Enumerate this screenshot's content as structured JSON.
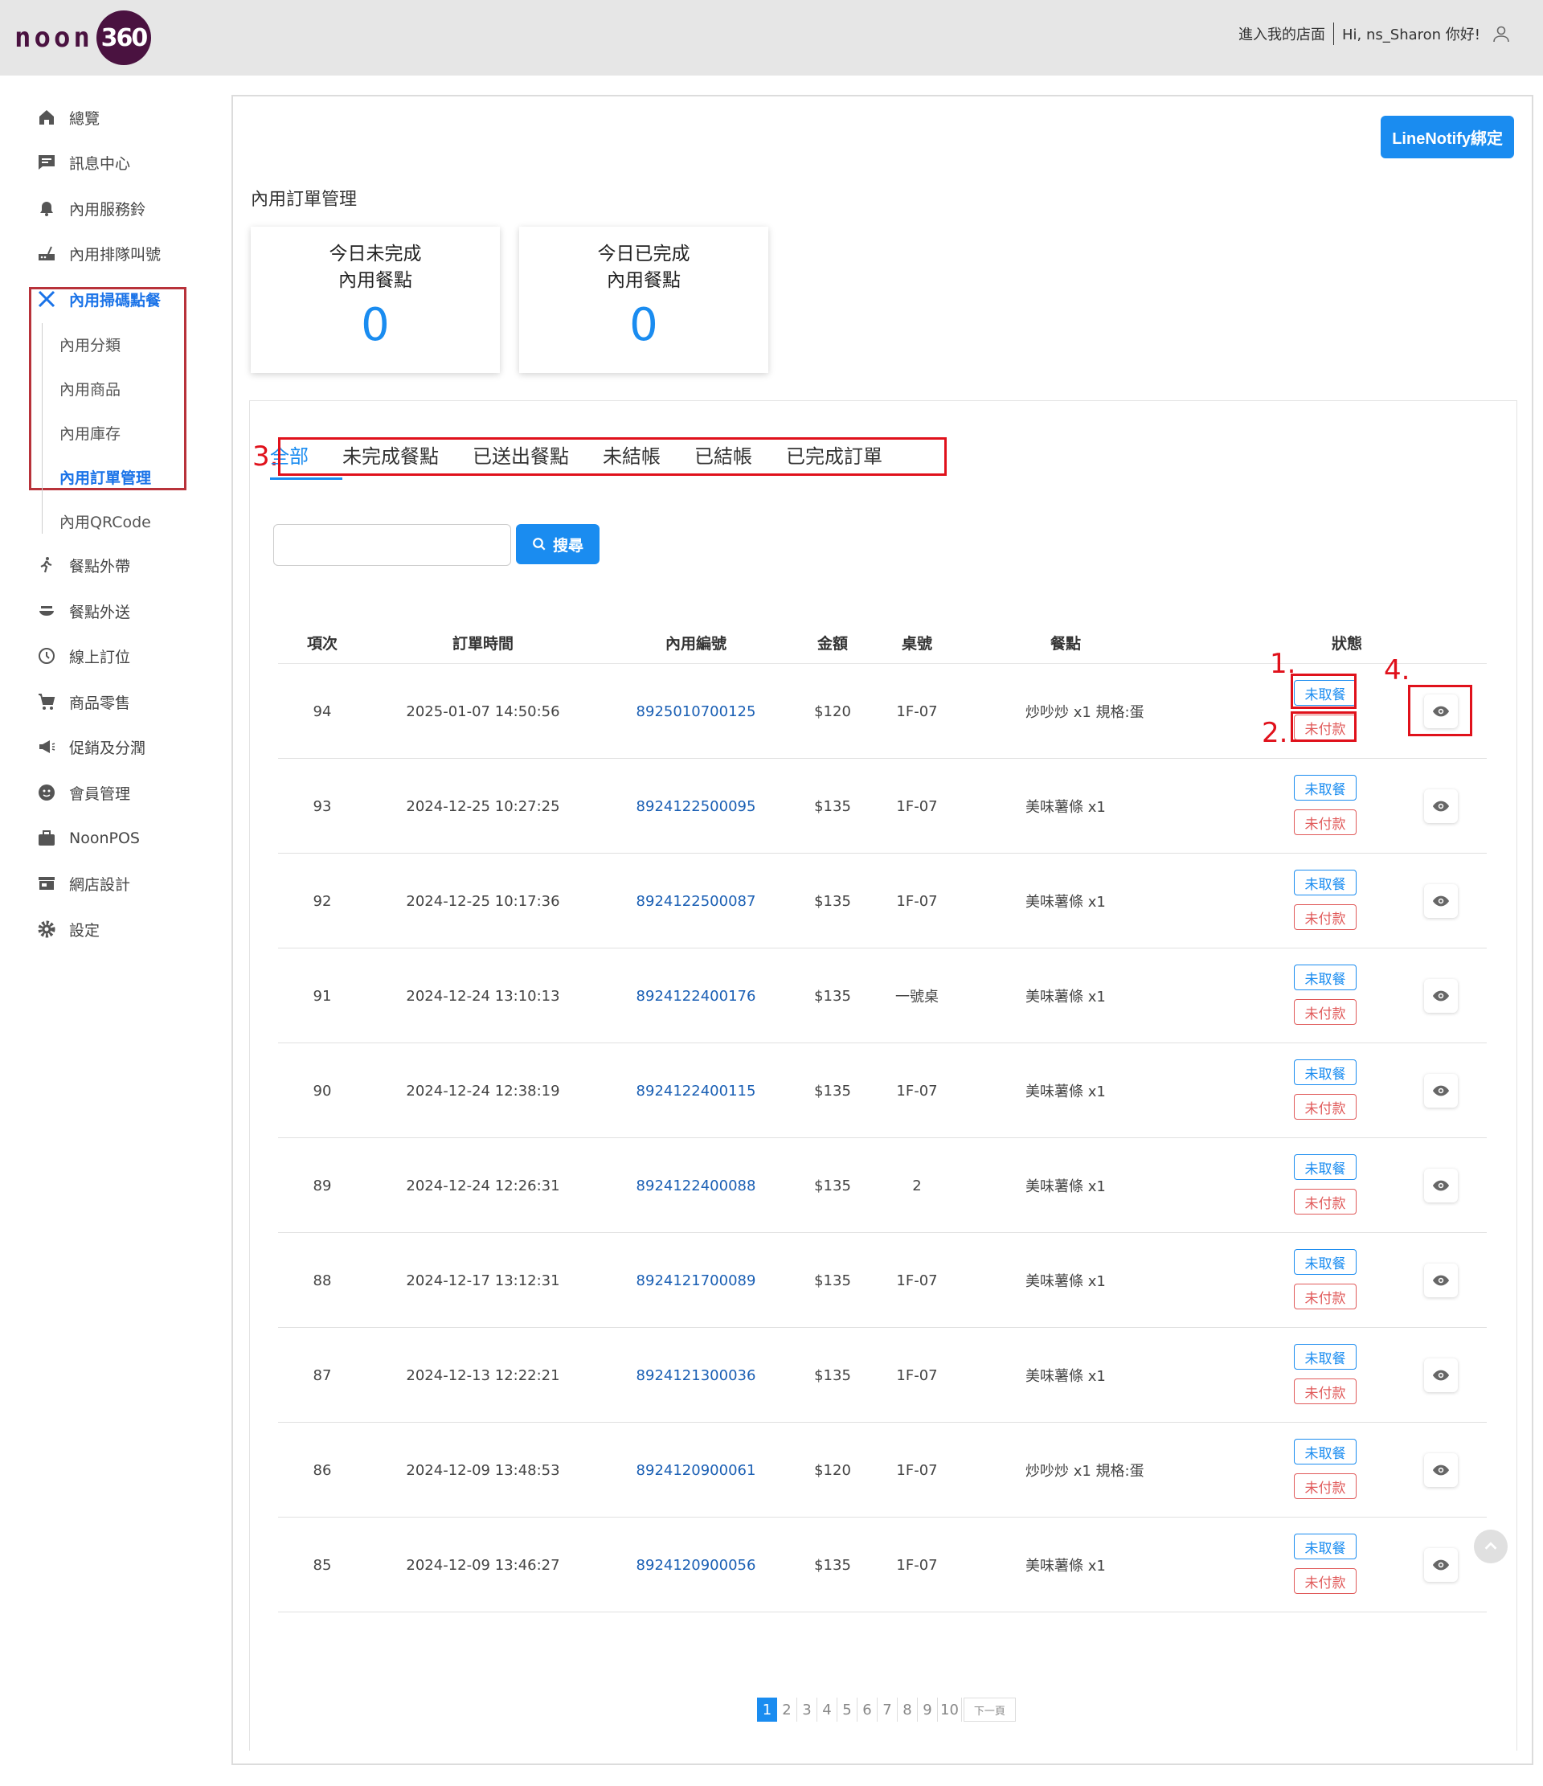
{
  "header": {
    "logo_text": "noon",
    "logo_badge": "360",
    "enter_store": "進入我的店面",
    "greeting": "Hi, ns_Sharon 你好!"
  },
  "sidebar": {
    "items": [
      {
        "label": "總覽",
        "icon": "home-icon"
      },
      {
        "label": "訊息中心",
        "icon": "message-icon"
      },
      {
        "label": "內用服務鈴",
        "icon": "bell-icon"
      },
      {
        "label": "內用排隊叫號",
        "icon": "queue-icon"
      },
      {
        "label": "內用掃碼點餐",
        "icon": "utensils-icon"
      },
      {
        "label": "餐點外帶",
        "icon": "walk-icon"
      },
      {
        "label": "餐點外送",
        "icon": "delivery-icon"
      },
      {
        "label": "線上訂位",
        "icon": "clock-icon"
      },
      {
        "label": "商品零售",
        "icon": "cart-icon"
      },
      {
        "label": "促銷及分潤",
        "icon": "megaphone-icon"
      },
      {
        "label": "會員管理",
        "icon": "member-icon"
      },
      {
        "label": "NoonPOS",
        "icon": "briefcase-icon"
      },
      {
        "label": "網店設計",
        "icon": "store-icon"
      },
      {
        "label": "設定",
        "icon": "gear-icon"
      }
    ],
    "subitems": [
      "內用分類",
      "內用商品",
      "內用庫存",
      "內用訂單管理",
      "內用QRCode"
    ]
  },
  "main": {
    "line_button": "LineNotify綁定",
    "title": "內用訂單管理",
    "stats": [
      {
        "label_line1": "今日未完成",
        "label_line2": "內用餐點",
        "value": "0"
      },
      {
        "label_line1": "今日已完成",
        "label_line2": "內用餐點",
        "value": "0"
      }
    ],
    "tabs": [
      "全部",
      "未完成餐點",
      "已送出餐點",
      "未結帳",
      "已結帳",
      "已完成訂單"
    ],
    "search": {
      "placeholder": "",
      "button": "搜尋"
    },
    "columns": [
      "項次",
      "訂單時間",
      "內用編號",
      "金額",
      "桌號",
      "餐點",
      "狀態"
    ],
    "rows": [
      {
        "no": "94",
        "time": "2025-01-07 14:50:56",
        "id": "8925010700125",
        "amount": "$120",
        "table": "1F-07",
        "items": "炒吵炒 x1 規格:蛋",
        "status1": "未取餐",
        "status2": "未付款"
      },
      {
        "no": "93",
        "time": "2024-12-25 10:27:25",
        "id": "8924122500095",
        "amount": "$135",
        "table": "1F-07",
        "items": "美味薯條 x1",
        "status1": "未取餐",
        "status2": "未付款"
      },
      {
        "no": "92",
        "time": "2024-12-25 10:17:36",
        "id": "8924122500087",
        "amount": "$135",
        "table": "1F-07",
        "items": "美味薯條 x1",
        "status1": "未取餐",
        "status2": "未付款"
      },
      {
        "no": "91",
        "time": "2024-12-24 13:10:13",
        "id": "8924122400176",
        "amount": "$135",
        "table": "一號桌",
        "items": "美味薯條 x1",
        "status1": "未取餐",
        "status2": "未付款"
      },
      {
        "no": "90",
        "time": "2024-12-24 12:38:19",
        "id": "8924122400115",
        "amount": "$135",
        "table": "1F-07",
        "items": "美味薯條 x1",
        "status1": "未取餐",
        "status2": "未付款"
      },
      {
        "no": "89",
        "time": "2024-12-24 12:26:31",
        "id": "8924122400088",
        "amount": "$135",
        "table": "2",
        "items": "美味薯條 x1",
        "status1": "未取餐",
        "status2": "未付款"
      },
      {
        "no": "88",
        "time": "2024-12-17 13:12:31",
        "id": "8924121700089",
        "amount": "$135",
        "table": "1F-07",
        "items": "美味薯條 x1",
        "status1": "未取餐",
        "status2": "未付款"
      },
      {
        "no": "87",
        "time": "2024-12-13 12:22:21",
        "id": "8924121300036",
        "amount": "$135",
        "table": "1F-07",
        "items": "美味薯條 x1",
        "status1": "未取餐",
        "status2": "未付款"
      },
      {
        "no": "86",
        "time": "2024-12-09 13:48:53",
        "id": "8924120900061",
        "amount": "$120",
        "table": "1F-07",
        "items": "炒吵炒 x1 規格:蛋",
        "status1": "未取餐",
        "status2": "未付款"
      },
      {
        "no": "85",
        "time": "2024-12-09 13:46:27",
        "id": "8924120900056",
        "amount": "$135",
        "table": "1F-07",
        "items": "美味薯條 x1",
        "status1": "未取餐",
        "status2": "未付款"
      }
    ],
    "pagination": {
      "pages": [
        "1",
        "2",
        "3",
        "4",
        "5",
        "6",
        "7",
        "8",
        "9",
        "10"
      ],
      "current": "1",
      "next": "下一頁"
    }
  },
  "annotations": [
    "1.",
    "2.",
    "3.",
    "4."
  ],
  "colors": {
    "accent": "#1a8cf0",
    "annotation_red": "#e0111b",
    "brand": "#4a1240"
  }
}
